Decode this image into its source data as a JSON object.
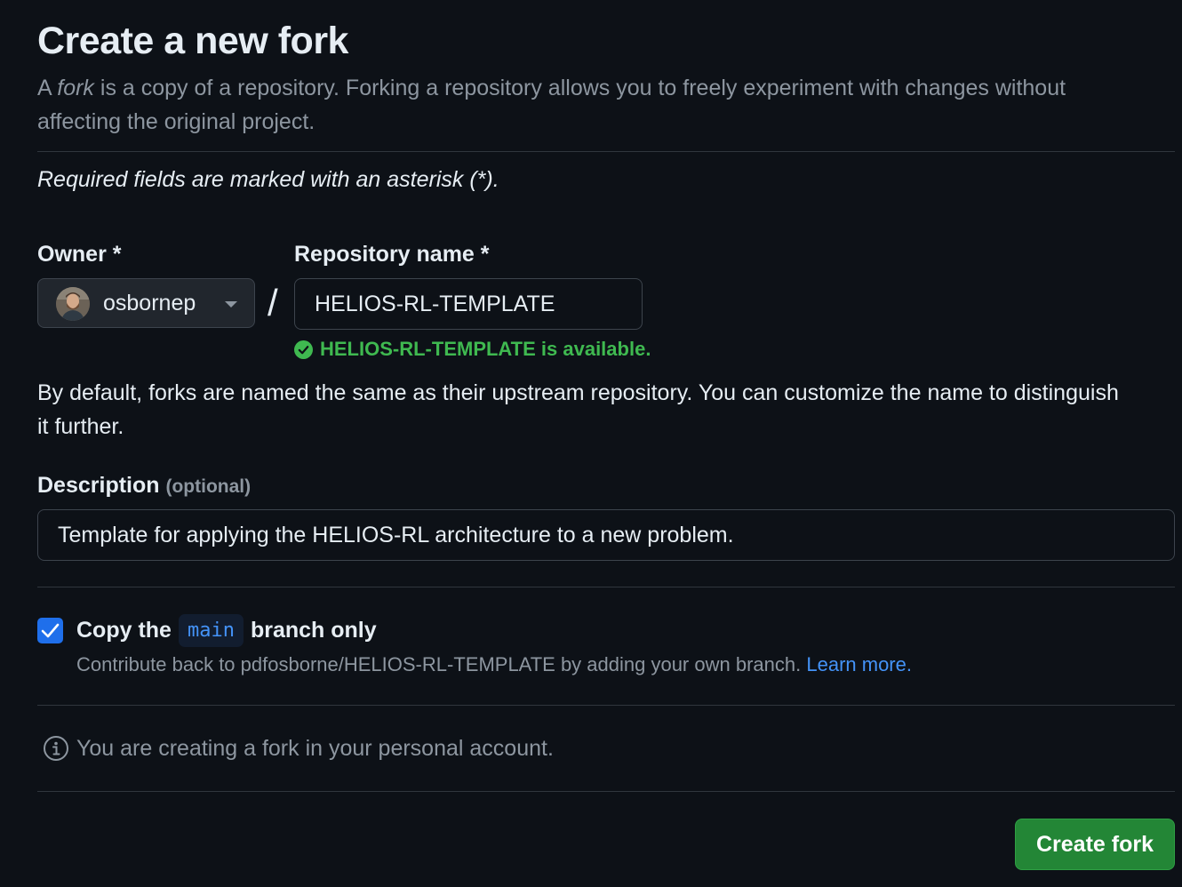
{
  "header": {
    "title": "Create a new fork",
    "subtitle_prefix": "A ",
    "subtitle_emph": "fork",
    "subtitle_rest": " is a copy of a repository. Forking a repository allows you to freely experiment with changes without affecting the original project."
  },
  "required_note": "Required fields are marked with an asterisk (*).",
  "owner": {
    "label": "Owner *",
    "value": "osbornep"
  },
  "repo": {
    "label": "Repository name *",
    "value": "HELIOS-RL-TEMPLATE",
    "availability": "HELIOS-RL-TEMPLATE is available."
  },
  "name_hint": "By default, forks are named the same as their upstream repository. You can customize the name to distinguish it further.",
  "description": {
    "label": "Description",
    "optional": "(optional)",
    "value": "Template for applying the HELIOS-RL architecture to a new problem."
  },
  "copy_branch": {
    "checked": true,
    "label_prefix": "Copy the",
    "branch": "main",
    "label_suffix": "branch only",
    "note": "Contribute back to pdfosborne/HELIOS-RL-TEMPLATE by adding your own branch.",
    "learn_more": "Learn more."
  },
  "info_note": "You are creating a fork in your personal account.",
  "actions": {
    "create_fork": "Create fork"
  },
  "colors": {
    "background": "#0d1117",
    "primary_button": "#238636",
    "success": "#3fb950",
    "accent": "#4493f8",
    "checkbox": "#1f6feb"
  },
  "icons": {
    "availability": "check-circle-icon",
    "dropdown": "triangle-down-icon",
    "info": "info-icon",
    "checkbox": "check-icon"
  }
}
